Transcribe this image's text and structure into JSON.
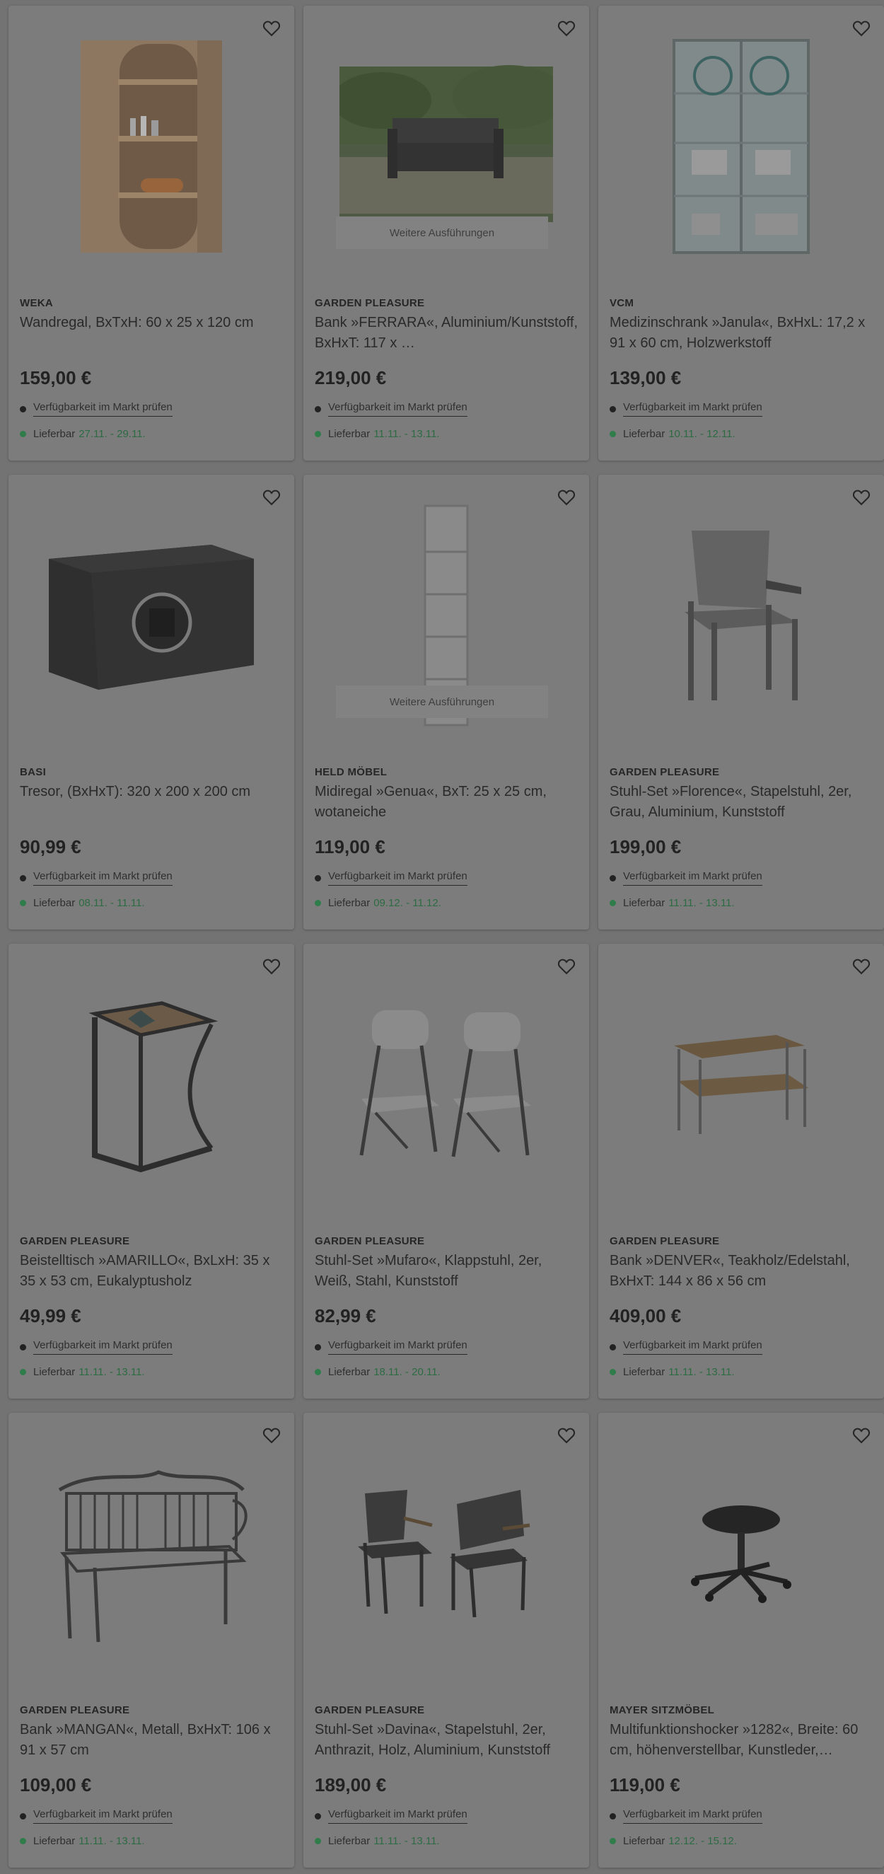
{
  "colors": {
    "background": "#737373",
    "card": "#7c7c7c",
    "delivery_dot": "#2e7d4a",
    "delivery_date": "#2d6b43"
  },
  "labels": {
    "availability": "Verfügbarkeit im Markt prüfen",
    "delivery": "Lieferbar",
    "variants": "Weitere Ausführungen"
  },
  "products": [
    {
      "brand": "WEKA",
      "title": "Wandregal, BxTxH: 60 x 25 x 120 cm",
      "price": "159,00 €",
      "delivery_date": "27.11. - 29.11.",
      "image": "wall-shelf-image",
      "has_variants": false
    },
    {
      "brand": "GARDEN PLEASURE",
      "title": "Bank »FERRARA«, Aluminium/Kunststoff, BxHxT: 117 x …",
      "price": "219,00 €",
      "delivery_date": "11.11. - 13.11.",
      "image": "garden-bench-photo",
      "has_variants": true
    },
    {
      "brand": "VCM",
      "title": "Medizinschrank »Janula«, BxHxL: 17,2 x 91 x 60 cm, Holzwerkstoff",
      "price": "139,00 €",
      "delivery_date": "10.11. - 12.11.",
      "image": "medicine-cabinet-image",
      "has_variants": false
    },
    {
      "brand": "BASI",
      "title": "Tresor, (BxHxT): 320 x 200 x 200 cm",
      "price": "90,99 €",
      "delivery_date": "08.11. - 11.11.",
      "image": "safe-image",
      "has_variants": false
    },
    {
      "brand": "HELD MÖBEL",
      "title": "Midiregal »Genua«, BxT: 25 x 25 cm, wotaneiche",
      "price": "119,00 €",
      "delivery_date": "09.12. - 11.12.",
      "image": "tall-shelf-image",
      "has_variants": true
    },
    {
      "brand": "GARDEN PLEASURE",
      "title": "Stuhl-Set »Florence«, Stapelstuhl, 2er, Grau, Aluminium, Kunststoff",
      "price": "199,00 €",
      "delivery_date": "11.11. - 13.11.",
      "image": "stacking-chair-image",
      "has_variants": false
    },
    {
      "brand": "GARDEN PLEASURE",
      "title": "Beistelltisch »AMARILLO«, BxLxH: 35 x 35 x 53 cm, Eukalyptusholz",
      "price": "49,99 €",
      "delivery_date": "11.11. - 13.11.",
      "image": "side-table-image",
      "has_variants": false
    },
    {
      "brand": "GARDEN PLEASURE",
      "title": "Stuhl-Set »Mufaro«, Klappstuhl, 2er, Weiß, Stahl, Kunststoff",
      "price": "82,99 €",
      "delivery_date": "18.11. - 20.11.",
      "image": "folding-chairs-image",
      "has_variants": false
    },
    {
      "brand": "GARDEN PLEASURE",
      "title": "Bank »DENVER«, Teakholz/Edelstahl, BxHxT: 144 x 86 x 56 cm",
      "price": "409,00 €",
      "delivery_date": "11.11. - 13.11.",
      "image": "teak-bench-image",
      "has_variants": false
    },
    {
      "brand": "GARDEN PLEASURE",
      "title": "Bank »MANGAN«, Metall, BxHxT: 106 x 91 x 57 cm",
      "price": "109,00 €",
      "delivery_date": "11.11. - 13.11.",
      "image": "metal-bench-image",
      "has_variants": false
    },
    {
      "brand": "GARDEN PLEASURE",
      "title": "Stuhl-Set »Davina«, Stapelstuhl, 2er, Anthrazit, Holz, Aluminium, Kunststoff",
      "price": "189,00 €",
      "delivery_date": "11.11. - 13.11.",
      "image": "anthracite-chairs-image",
      "has_variants": false
    },
    {
      "brand": "MAYER SITZMÖBEL",
      "title": "Multifunktionshocker »1282«, Breite: 60 cm, höhenverstellbar, Kunstleder,…",
      "price": "119,00 €",
      "delivery_date": "12.12. - 15.12.",
      "image": "stool-image",
      "has_variants": false
    }
  ]
}
